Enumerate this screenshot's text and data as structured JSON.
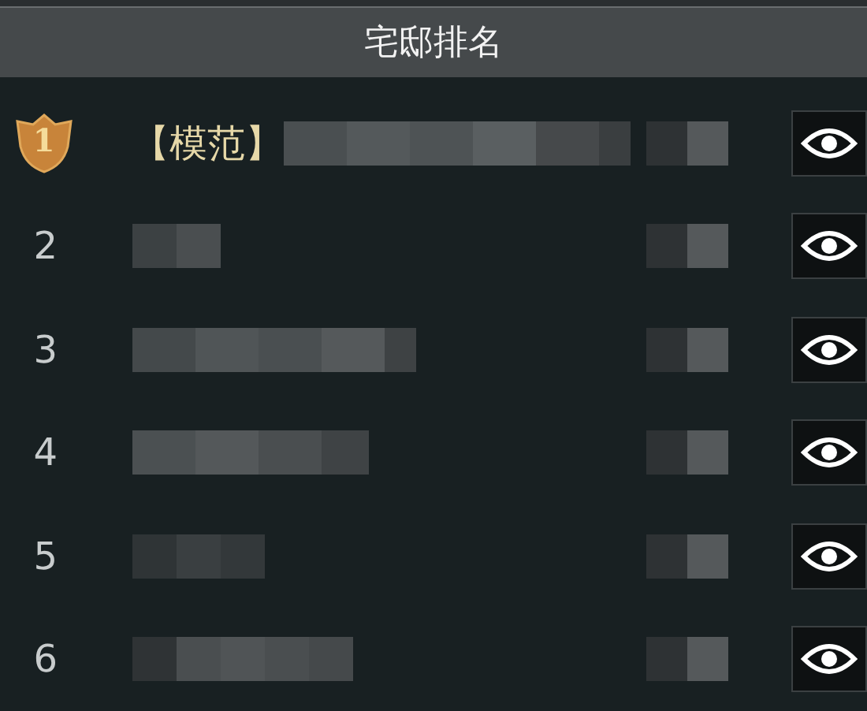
{
  "window": {
    "title": "宅邸排名"
  },
  "rows": [
    {
      "rank": "1",
      "kind": "badge",
      "title": "【模范】"
    },
    {
      "rank": "2",
      "kind": "number"
    },
    {
      "rank": "3",
      "kind": "number"
    },
    {
      "rank": "4",
      "kind": "number"
    },
    {
      "rank": "5",
      "kind": "number"
    },
    {
      "rank": "6",
      "kind": "number"
    }
  ]
}
